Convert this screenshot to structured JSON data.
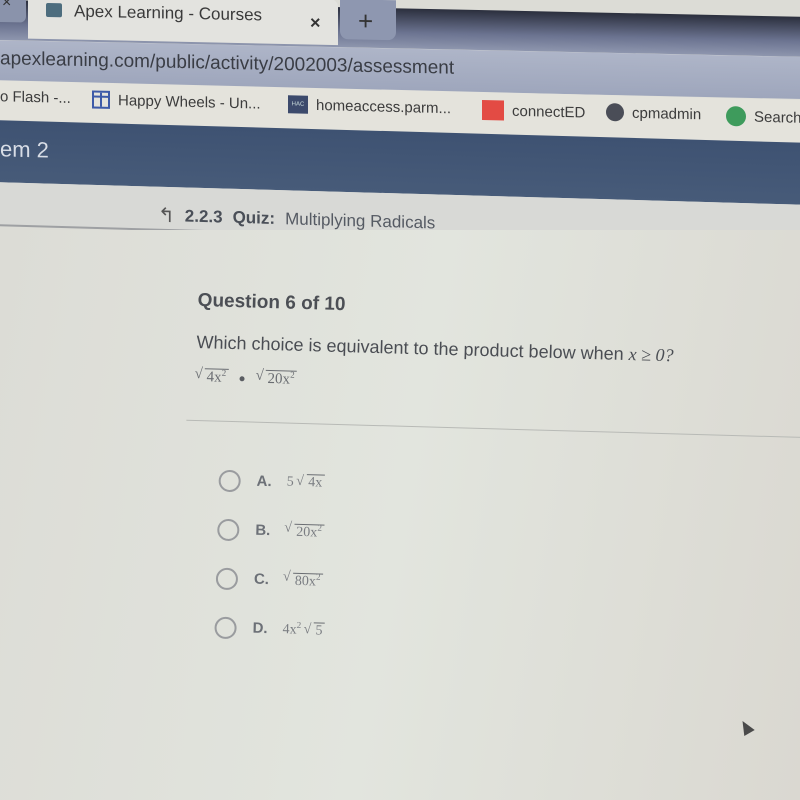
{
  "browser": {
    "tab": {
      "title": "Apex Learning - Courses",
      "close_glyph": "×"
    },
    "new_tab_glyph": "+",
    "prev_tab_glyph": "×",
    "url": "apexlearning.com/public/activity/2002003/assessment",
    "bookmarks": [
      {
        "label": "o Flash -...",
        "icon": "none"
      },
      {
        "label": "Happy Wheels - Un...",
        "icon": "page-icon"
      },
      {
        "label": "homeaccess.parm...",
        "icon": "hac-icon",
        "icon_text": "HAC"
      },
      {
        "label": "connectED",
        "icon": "mcgraw-hill-icon"
      },
      {
        "label": "cpmadmin",
        "icon": "globe-icon"
      },
      {
        "label": "Search",
        "icon": "spotify-icon"
      }
    ]
  },
  "app_header": {
    "title": "em 2"
  },
  "breadcrumb": {
    "back_glyph": "↰",
    "number": "2.2.3",
    "kind": "Quiz:",
    "title": "Multiplying Radicals"
  },
  "question": {
    "counter": "Question 6 of 10",
    "prompt_prefix": "Which choice is equivalent to the product below when ",
    "prompt_condition": "x ≥ 0?",
    "expression": {
      "left_radicand": "4x",
      "left_exp": "2",
      "operator": "•",
      "right_radicand": "20x",
      "right_exp": "2"
    }
  },
  "choices": [
    {
      "letter": "A.",
      "coef": "5",
      "radicand": "4x",
      "exp": "",
      "outer": ""
    },
    {
      "letter": "B.",
      "coef": "",
      "radicand": "20x",
      "exp": "2",
      "outer": ""
    },
    {
      "letter": "C.",
      "coef": "",
      "radicand": "80x",
      "exp": "2",
      "outer": ""
    },
    {
      "letter": "D.",
      "coef": "4x",
      "coef_exp": "2",
      "radicand": "5",
      "exp": "",
      "outer": ""
    }
  ],
  "colors": {
    "header_bg": "#3e5272",
    "bookmark_bar_bg": "#e4e3dc",
    "url_bar_bg": "#aeb5c8"
  }
}
